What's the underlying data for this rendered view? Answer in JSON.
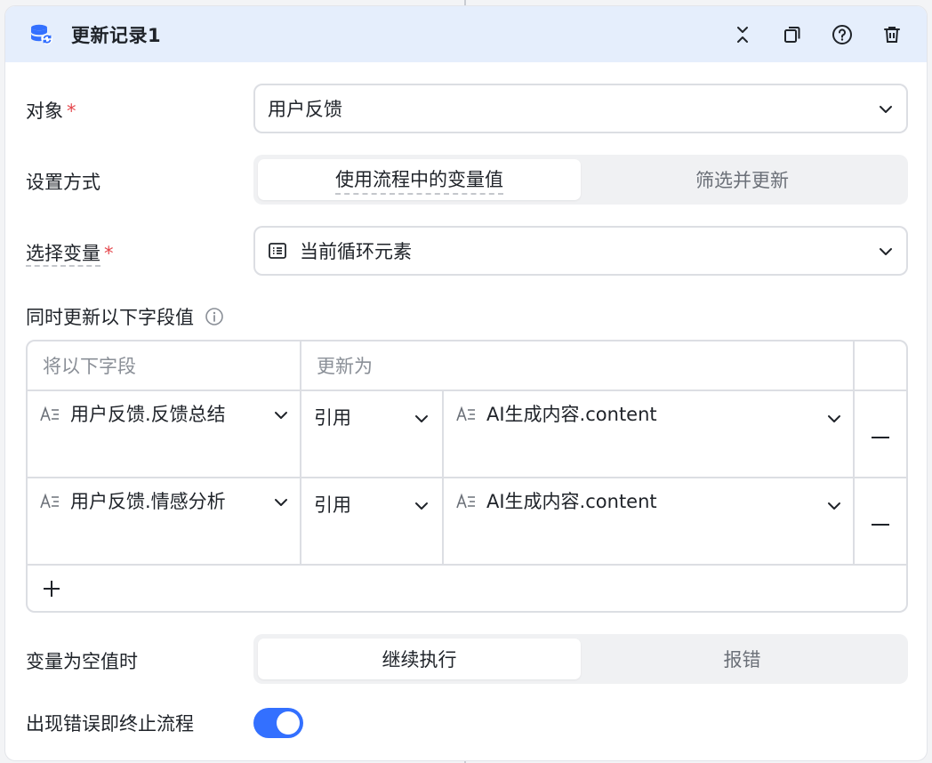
{
  "node": {
    "title": "更新记录1",
    "icon": "database-refresh-icon",
    "actions": [
      "collapse-icon",
      "copy-icon",
      "help-icon",
      "delete-icon"
    ]
  },
  "object": {
    "label": "对象",
    "required": "*",
    "value": "用户反馈"
  },
  "setting_mode": {
    "label": "设置方式",
    "options": [
      "使用流程中的变量值",
      "筛选并更新"
    ],
    "selected": "使用流程中的变量值"
  },
  "variable": {
    "label": "选择变量",
    "required": "*",
    "value": "当前循环元素",
    "icon": "list-icon"
  },
  "fields_section": {
    "label": "同时更新以下字段值",
    "info_icon": "info-icon",
    "headers": {
      "field": "将以下字段",
      "update_to": "更新为"
    },
    "rows": [
      {
        "field": "用户反馈.反馈总结",
        "ref": "引用",
        "value": "AI生成内容.content"
      },
      {
        "field": "用户反馈.情感分析",
        "ref": "引用",
        "value": "AI生成内容.content"
      }
    ],
    "add_icon": "plus-icon",
    "remove_icon": "minus-icon"
  },
  "empty_value": {
    "label": "变量为空值时",
    "options": [
      "继续执行",
      "报错"
    ],
    "selected": "继续执行"
  },
  "stop_on_error": {
    "label": "出现错误即终止流程",
    "enabled": true
  },
  "colors": {
    "accent": "#3370ff",
    "header_bg": "#e5eefc",
    "required": "#e5484d"
  }
}
